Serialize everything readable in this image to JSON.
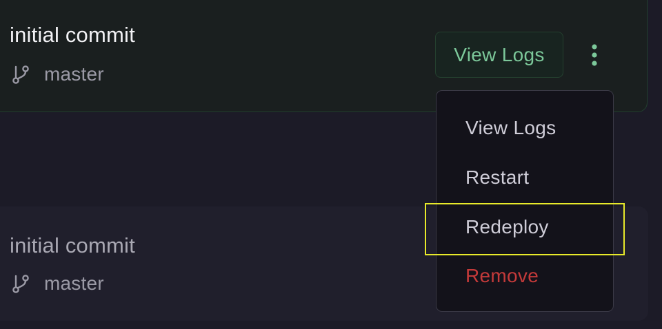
{
  "deployments": [
    {
      "commit_message": "initial commit",
      "branch": "master",
      "branch_icon": "git-branch-icon",
      "state": "active"
    },
    {
      "commit_message": "initial commit",
      "branch": "master",
      "branch_icon": "git-branch-icon",
      "state": "inactive"
    }
  ],
  "actions": {
    "view_logs_label": "View Logs",
    "more_icon": "kebab-menu-icon"
  },
  "menu": {
    "items": [
      {
        "label": "View Logs"
      },
      {
        "label": "Restart"
      },
      {
        "label": "Redeploy"
      },
      {
        "label": "Remove",
        "color": "#c43a3a"
      }
    ]
  },
  "colors": {
    "accent": "#7cc89a",
    "danger": "#c43a3a",
    "highlight": "#e8ea2a"
  }
}
